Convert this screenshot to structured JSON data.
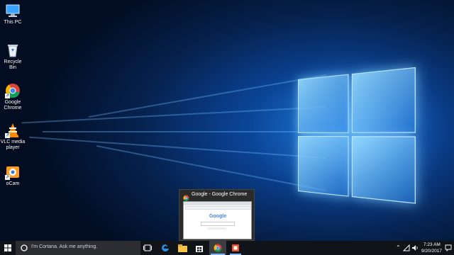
{
  "desktop": {
    "icons": [
      {
        "label": "This PC",
        "icon": "this-pc-icon"
      },
      {
        "label": "Recycle Bin",
        "icon": "recycle-bin-icon"
      },
      {
        "label": "Google Chrome",
        "icon": "chrome-icon"
      },
      {
        "label": "VLC media player",
        "icon": "vlc-icon"
      },
      {
        "label": "oCam",
        "icon": "ocam-icon"
      }
    ]
  },
  "preview": {
    "title": "Google - Google Chrome",
    "thumbnail_logo": "Google"
  },
  "taskbar": {
    "search_placeholder": "I'm Cortana. Ask me anything.",
    "apps": [
      "task-view-icon",
      "edge-icon",
      "file-explorer-icon",
      "store-icon",
      "chrome-icon",
      "office-icon"
    ],
    "active_app": "chrome-icon"
  },
  "tray": {
    "time": "7:23 AM",
    "date": "9/20/2017"
  },
  "colors": {
    "accent": "#0a63c9",
    "taskbar": "#101317"
  }
}
